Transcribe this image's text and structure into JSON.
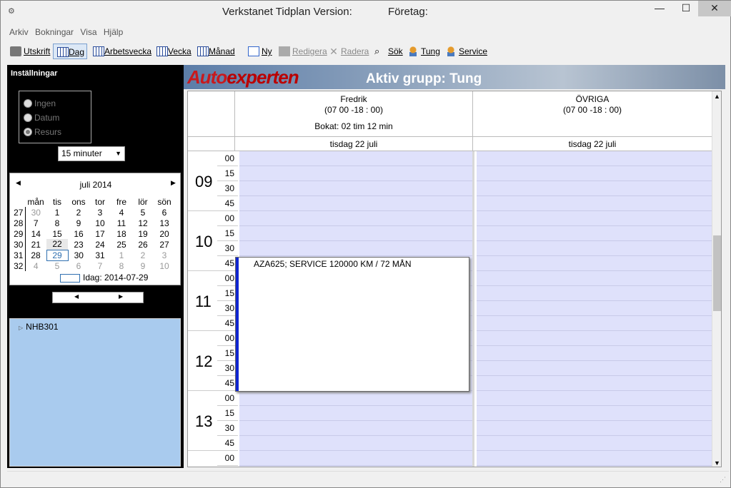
{
  "window": {
    "title": "Verkstanet Tidplan Version:",
    "company_label": "Företag:",
    "min": "—",
    "max": "☐",
    "close": "✕"
  },
  "menu": [
    "Arkiv",
    "Bokningar",
    "Visa",
    "Hjälp"
  ],
  "toolbar": {
    "print": "Utskrift",
    "day": "Dag",
    "workweek": "Arbetsvecka",
    "week": "Vecka",
    "month": "Månad",
    "new": "Ny",
    "edit": "Redigera",
    "delete": "Radera",
    "search": "Sök",
    "heavy": "Tung",
    "service": "Service"
  },
  "settings": {
    "title": "Inställningar",
    "radios": [
      "Ingen",
      "Datum",
      "Resurs"
    ],
    "selected_radio": "Resurs",
    "interval": "15 minuter"
  },
  "calendar": {
    "month_title": "juli 2014",
    "weekdays": [
      "mån",
      "tis",
      "ons",
      "tor",
      "fre",
      "lör",
      "sön"
    ],
    "weeks": [
      {
        "wk": "27",
        "days": [
          "30",
          "1",
          "2",
          "3",
          "4",
          "5",
          "6"
        ]
      },
      {
        "wk": "28",
        "days": [
          "7",
          "8",
          "9",
          "10",
          "11",
          "12",
          "13"
        ]
      },
      {
        "wk": "29",
        "days": [
          "14",
          "15",
          "16",
          "17",
          "18",
          "19",
          "20"
        ]
      },
      {
        "wk": "30",
        "days": [
          "21",
          "22",
          "23",
          "24",
          "25",
          "26",
          "27"
        ]
      },
      {
        "wk": "31",
        "days": [
          "28",
          "29",
          "30",
          "31",
          "1",
          "2",
          "3"
        ]
      },
      {
        "wk": "32",
        "days": [
          "4",
          "5",
          "6",
          "7",
          "8",
          "9",
          "10"
        ]
      }
    ],
    "today_label": "Idag: 2014-07-29"
  },
  "tree": {
    "node": "NHB301"
  },
  "banner": {
    "logo_a": "Auto",
    "logo_b": "experten",
    "group": "Aktiv grupp:  Tung"
  },
  "resources": [
    {
      "name": "Fredrik",
      "hours": "(07  00 -18 : 00)",
      "booked": "Bokat: 02 tim 12 min",
      "date": "tisdag 22 juli"
    },
    {
      "name": "ÖVRIGA",
      "hours": "(07  00 -18 : 00)",
      "booked": "",
      "date": "tisdag 22 juli"
    }
  ],
  "hours": [
    "09",
    "10",
    "11",
    "12",
    "13"
  ],
  "quarters": [
    "00",
    "15",
    "30",
    "45"
  ],
  "booking": {
    "text": "AZA625; SERVICE 120000 KM / 72 MÅN"
  }
}
